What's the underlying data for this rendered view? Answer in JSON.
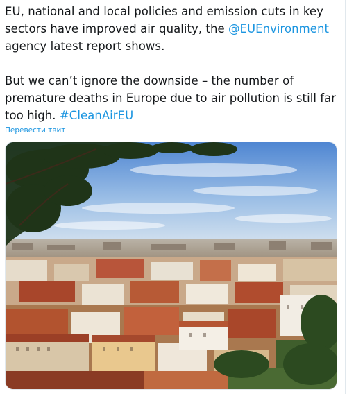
{
  "tweet": {
    "paragraph1": {
      "text_before_mention": "EU, national and local policies and emission cuts in key sectors have improved air quality, the ",
      "mention": "@EUEnvironment",
      "text_after_mention": " agency latest report shows."
    },
    "paragraph2": {
      "text_before_hashtag": "But we can’t ignore the downside – the number of premature deaths in Europe due to air pollution is still far too high. ",
      "hashtag": "#CleanAirEU"
    },
    "translate_link": "Перевести твит"
  },
  "media": {
    "icon": "photo-cityscape",
    "colors": {
      "sky_top": "#5b8fd6",
      "sky_bottom": "#c9dcef",
      "roofs": "#b2532f",
      "walls": "#e8dcc8",
      "foliage": "#2f4a22"
    }
  },
  "colors": {
    "text": "#14171a",
    "link": "#1b95e0",
    "border": "#e1e8ed"
  }
}
